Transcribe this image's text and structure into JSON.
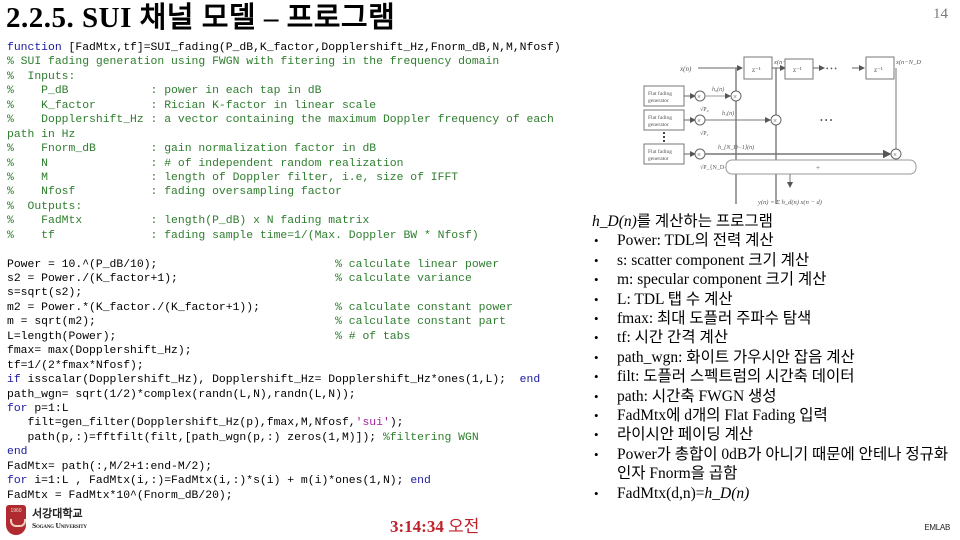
{
  "slide": {
    "title": "2.2.5. SUI 채널 모델 – 프로그램",
    "page_number": "14"
  },
  "code": {
    "lines": [
      {
        "parts": [
          [
            "kw",
            "function"
          ],
          [
            "tx",
            " [FadMtx,tf]=SUI_fading(P_dB,K_factor,Dopplershift_Hz,Fnorm_dB,N,M,Nfosf)"
          ]
        ]
      },
      {
        "parts": [
          [
            "cm",
            "% SUI fading generation using FWGN with fitering in the frequency domain"
          ]
        ]
      },
      {
        "parts": [
          [
            "cm",
            "%  Inputs:"
          ]
        ]
      },
      {
        "parts": [
          [
            "cm",
            "%    P_dB            : power in each tap in dB"
          ]
        ]
      },
      {
        "parts": [
          [
            "cm",
            "%    K_factor        : Rician K-factor in linear scale"
          ]
        ]
      },
      {
        "parts": [
          [
            "cm",
            "%    Dopplershift_Hz : a vector containing the maximum Doppler frequency of each"
          ]
        ]
      },
      {
        "parts": [
          [
            "cm",
            "path in Hz"
          ]
        ]
      },
      {
        "parts": [
          [
            "cm",
            "%    Fnorm_dB        : gain normalization factor in dB"
          ]
        ]
      },
      {
        "parts": [
          [
            "cm",
            "%    N               : # of independent random realization"
          ]
        ]
      },
      {
        "parts": [
          [
            "cm",
            "%    M               : length of Doppler filter, i.e, size of IFFT"
          ]
        ]
      },
      {
        "parts": [
          [
            "cm",
            "%    Nfosf           : fading oversampling factor"
          ]
        ]
      },
      {
        "parts": [
          [
            "cm",
            "%  Outputs:"
          ]
        ]
      },
      {
        "parts": [
          [
            "cm",
            "%    FadMtx          : length(P_dB) x N fading matrix"
          ]
        ]
      },
      {
        "parts": [
          [
            "cm",
            "%    tf              : fading sample time=1/(Max. Doppler BW * Nfosf)"
          ]
        ]
      },
      {
        "parts": []
      },
      {
        "parts": [
          [
            "tx",
            "Power = 10.^(P_dB/10);                          "
          ],
          [
            "cm",
            "% calculate linear power"
          ]
        ]
      },
      {
        "parts": [
          [
            "tx",
            "s2 = Power./(K_factor+1);                       "
          ],
          [
            "cm",
            "% calculate variance"
          ]
        ]
      },
      {
        "parts": [
          [
            "tx",
            "s=sqrt(s2);"
          ]
        ]
      },
      {
        "parts": [
          [
            "tx",
            "m2 = Power.*(K_factor./(K_factor+1));           "
          ],
          [
            "cm",
            "% calculate constant power"
          ]
        ]
      },
      {
        "parts": [
          [
            "tx",
            "m = sqrt(m2);                                   "
          ],
          [
            "cm",
            "% calculate constant part"
          ]
        ]
      },
      {
        "parts": [
          [
            "tx",
            "L=length(Power);                                "
          ],
          [
            "cm",
            "% # of tabs"
          ]
        ]
      },
      {
        "parts": [
          [
            "tx",
            "fmax= max(Dopplershift_Hz);"
          ]
        ]
      },
      {
        "parts": [
          [
            "tx",
            "tf=1/(2*fmax*Nfosf);"
          ]
        ]
      },
      {
        "parts": [
          [
            "kw",
            "if"
          ],
          [
            "tx",
            " isscalar(Dopplershift_Hz), Dopplershift_Hz= Dopplershift_Hz*ones(1,L);  "
          ],
          [
            "kw",
            "end"
          ]
        ]
      },
      {
        "parts": [
          [
            "tx",
            "path_wgn= sqrt(1/2)*complex(randn(L,N),randn(L,N));"
          ]
        ]
      },
      {
        "parts": [
          [
            "kw",
            "for"
          ],
          [
            "tx",
            " p=1:L"
          ]
        ]
      },
      {
        "parts": [
          [
            "tx",
            "   filt=gen_filter(Dopplershift_Hz(p),fmax,M,Nfosf,"
          ],
          [
            "st",
            "'sui'"
          ],
          [
            "tx",
            ");"
          ]
        ]
      },
      {
        "parts": [
          [
            "tx",
            "   path(p,:)=fftfilt(filt,[path_wgn(p,:) zeros(1,M)]); "
          ],
          [
            "cm",
            "%filtering WGN"
          ]
        ]
      },
      {
        "parts": [
          [
            "kw",
            "end"
          ]
        ]
      },
      {
        "parts": [
          [
            "tx",
            "FadMtx= path(:,M/2+1:end-M/2);"
          ]
        ]
      },
      {
        "parts": [
          [
            "kw",
            "for"
          ],
          [
            "tx",
            " i=1:L , FadMtx(i,:)=FadMtx(i,:)*s(i) + m(i)*ones(1,N); "
          ],
          [
            "kw",
            "end"
          ]
        ]
      },
      {
        "parts": [
          [
            "tx",
            "FadMtx = FadMtx*10^(Fnorm_dB/20);"
          ]
        ]
      }
    ]
  },
  "diagram": {
    "input_label": "x(n)",
    "delay_labels": [
      "z⁻¹",
      "z⁻¹",
      "z⁻¹"
    ],
    "tap_labels": [
      "x(n−1)",
      "x(n−N_D+1)"
    ],
    "generator_label_line1": "Flat fading",
    "generator_label_line2": "generator",
    "channel_labels": [
      "h₀(n)",
      "h₁(n)",
      "h_{N_D−1}(n)"
    ],
    "gain_labels": [
      "√P₀",
      "√P₁",
      "√P_{N_D−1}"
    ],
    "sum_label": "+",
    "ellipsis": "• • •",
    "output_formula": "y(n) = Σ h_d(n) x(n − d)"
  },
  "bullets": {
    "heading_math": "h_D(n)",
    "heading_text": "를 계산하는 프로그램",
    "items": [
      "Power: TDL의 전력 계산",
      "s: scatter component 크기 계산",
      "m: specular component 크기 계산",
      "L: TDL 탭 수 계산",
      "fmax: 최대 도플러 주파수 탐색",
      "tf: 시간 간격 계산",
      "path_wgn: 화이트 가우시안 잡음 계산",
      "filt: 도플러 스펙트럼의 시간축 데이터",
      "path: 시간축 FWGN 생성",
      "FadMtx에 d개의 Flat Fading 입력",
      "라이시안 페이딩 계산",
      "Power가 총합이 0dB가 아니기 때문에 안테나 정규화인자 Fnorm을 곱함"
    ],
    "last_item_prefix": "FadMtx(d,n)=",
    "last_item_math": "h_D(n)"
  },
  "footer": {
    "logo_shield_text": "1960",
    "logo_korean": "서강대학교",
    "logo_english": "Sogang University",
    "clock_time": "3:14:34",
    "clock_ampm": "오전",
    "lab_name": "EMLAB"
  },
  "colors": {
    "comment": "#2e7d2e",
    "keyword": "#1a1aa0",
    "string": "#a020a0",
    "clock": "#c0202a",
    "logo": "#b02a30"
  }
}
